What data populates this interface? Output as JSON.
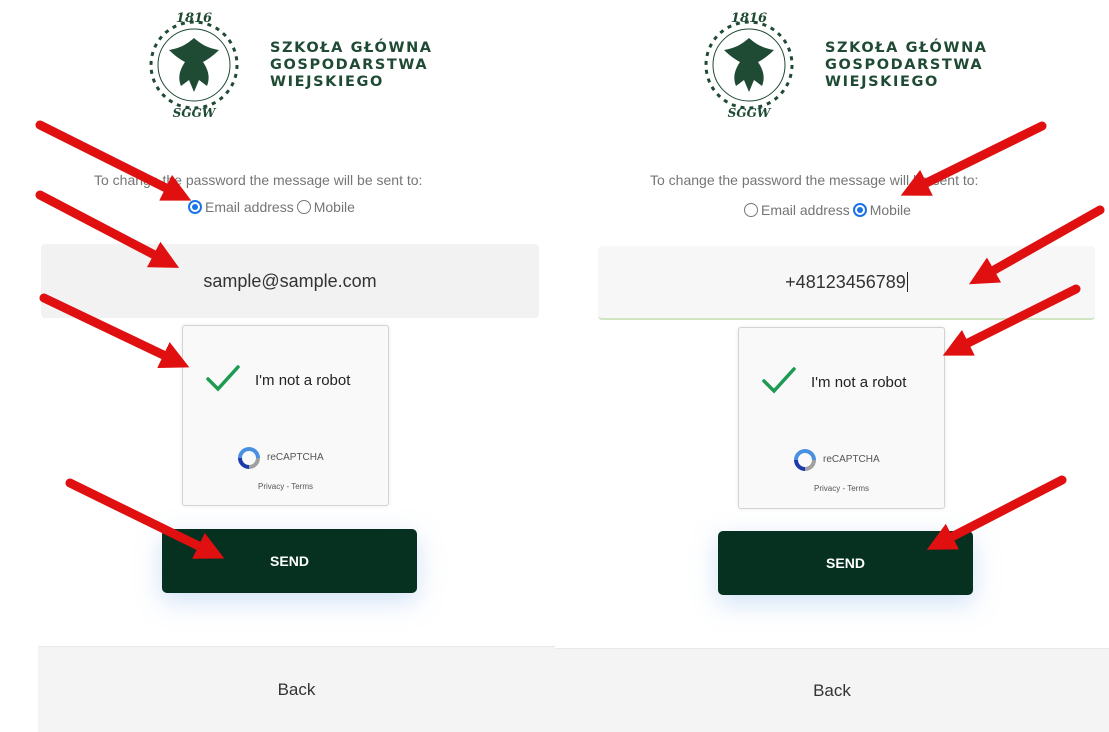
{
  "university": {
    "line1": "SZKOŁA GŁÓWNA",
    "line2": "GOSPODARSTWA",
    "line3": "WIEJSKIEGO",
    "seal_year": "1816",
    "seal_abbrev": "SGGW"
  },
  "colors": {
    "brand_green": "#1f4a34",
    "send_bg": "#06301f",
    "radio_blue": "#1a73e8",
    "arrow_red": "#e01010"
  },
  "left_panel": {
    "prompt": "To change the password the message will be sent to:",
    "option_email": "Email address",
    "option_mobile": "Mobile",
    "selected": "email",
    "field_value": "sample@sample.com",
    "captcha_label": "I'm not a robot",
    "captcha_brand": "reCAPTCHA",
    "captcha_links": "Privacy - Terms",
    "send_label": "SEND",
    "back_label": "Back"
  },
  "right_panel": {
    "prompt": "To change the password the message will be sent to:",
    "option_email": "Email address",
    "option_mobile": "Mobile",
    "selected": "mobile",
    "field_value": "+48123456789",
    "captcha_label": "I'm not a robot",
    "captcha_brand": "reCAPTCHA",
    "captcha_links": "Privacy - Terms",
    "send_label": "SEND",
    "back_label": "Back"
  }
}
